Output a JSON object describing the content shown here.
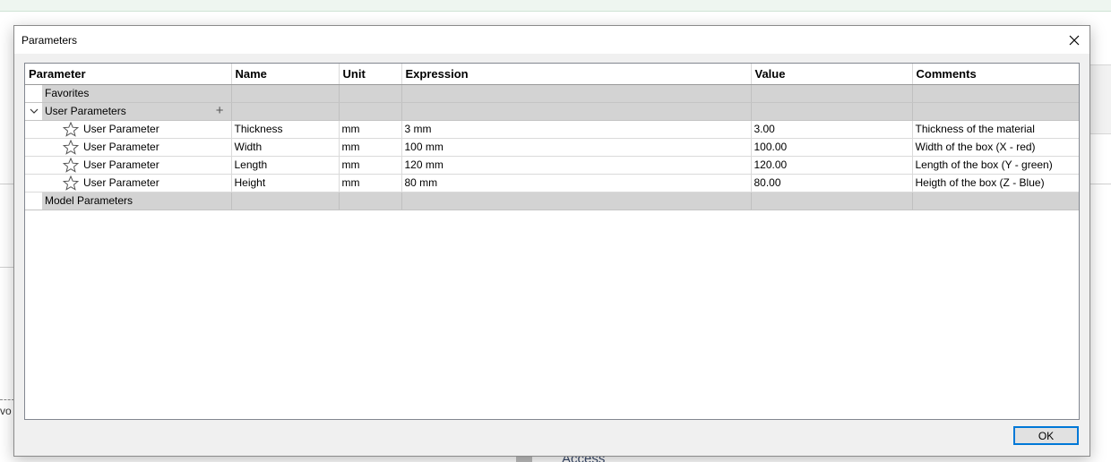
{
  "dialog": {
    "title": "Parameters",
    "ok_label": "OK"
  },
  "columns": [
    "Parameter",
    "Name",
    "Unit",
    "Expression",
    "Value",
    "Comments"
  ],
  "groups": {
    "favorites": "Favorites",
    "user_parameters": "User Parameters",
    "model_parameters": "Model Parameters"
  },
  "rows": [
    {
      "type": "User Parameter",
      "name": "Thickness",
      "unit": "mm",
      "expression": "3 mm",
      "value": "3.00",
      "comment": "Thickness of the material"
    },
    {
      "type": "User Parameter",
      "name": "Width",
      "unit": "mm",
      "expression": "100 mm",
      "value": "100.00",
      "comment": "Width of the box (X - red)"
    },
    {
      "type": "User Parameter",
      "name": "Length",
      "unit": "mm",
      "expression": "120 mm",
      "value": "120.00",
      "comment": "Length of the box (Y - green)"
    },
    {
      "type": "User Parameter",
      "name": "Height",
      "unit": "mm",
      "expression": "80 mm",
      "value": "80.00",
      "comment": "Heigth of the box (Z - Blue)"
    }
  ],
  "background": {
    "partial_left_text": "vo",
    "partial_bottom_text": "Access"
  }
}
